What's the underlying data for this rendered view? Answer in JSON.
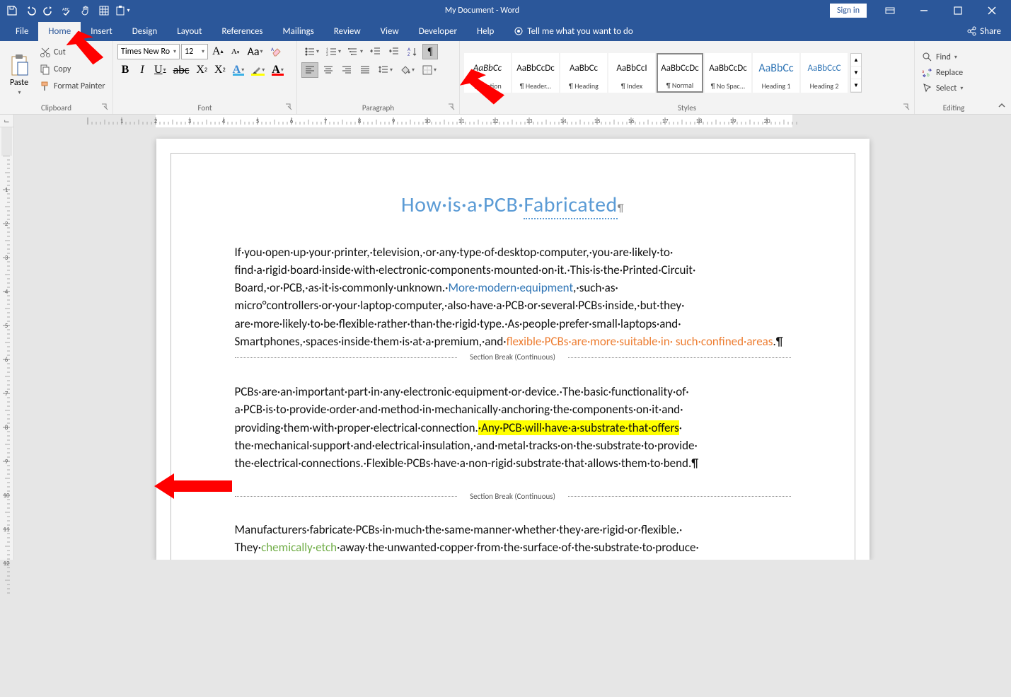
{
  "titlebar": {
    "title": "My Document  -  Word",
    "signin": "Sign in"
  },
  "tabs": {
    "file": "File",
    "home": "Home",
    "insert": "Insert",
    "design": "Design",
    "layout": "Layout",
    "references": "References",
    "mailings": "Mailings",
    "review": "Review",
    "view": "View",
    "developer": "Developer",
    "help": "Help",
    "tellme": "Tell me what you want to do",
    "share": "Share"
  },
  "ribbon": {
    "clipboard": {
      "label": "Clipboard",
      "paste": "Paste",
      "cut": "Cut",
      "copy": "Copy",
      "format_painter": "Format Painter"
    },
    "font": {
      "label": "Font",
      "name": "Times New Ro",
      "size": "12"
    },
    "paragraph": {
      "label": "Paragraph"
    },
    "styles": {
      "label": "Styles",
      "items": [
        {
          "preview": "AaBbCc",
          "name": "¶ Caption",
          "italic": true
        },
        {
          "preview": "AaBbCcDc",
          "name": "¶ Header..."
        },
        {
          "preview": "AaBbCc",
          "name": "¶ Heading"
        },
        {
          "preview": "AaBbCcI",
          "name": "¶ Index"
        },
        {
          "preview": "AaBbCcDc",
          "name": "¶ Normal",
          "selected": true
        },
        {
          "preview": "AaBbCcDc",
          "name": "¶ No Spac..."
        },
        {
          "preview": "AaBbCc",
          "name": "Heading 1",
          "color": "#2e74b5",
          "size": "16px"
        },
        {
          "preview": "AaBbCcC",
          "name": "Heading 2",
          "color": "#2e74b5"
        }
      ]
    },
    "editing": {
      "label": "Editing",
      "find": "Find",
      "replace": "Replace",
      "select": "Select"
    }
  },
  "document": {
    "title_pre": "How·is·a·PCB·",
    "title_u": "Fabricated",
    "title_mark": "¶",
    "p1_a": "If·you·open·up·your·printer,·television,·or·any·type·of·desktop·computer,·you·are·likely·to· find·a·rigid·board·inside·with·electronic·components·mounted·on·it.·This·is·the·Printed·Circuit· Board,·or·PCB,·as·it·is·commonly·unknown.·",
    "p1_link1": "More·modern·equipment",
    "p1_b": ",·such·as· micro°controllers·or·your·laptop·computer,·also·have·a·PCB·or·several·PCBs·inside,·but·they· are·more·likely·to·be·flexible·rather·than·the·rigid·type.·As·people·prefer·small·laptops·and· Smartphones,·spaces·inside·them·is·at·a·premium,·and·",
    "p1_link2": "flexible·PCBs·are·more·suitable·in· such·confined·areas",
    "p1_c": ".¶",
    "sb1": "Section Break (Continuous)",
    "p2_a": "PCBs·are·an·important·part·in·any·electronic·equipment·or·device.·The·basic·functionality·of· a·PCB·is·to·provide·order·and·method·in·mechanically·anchoring·the·components·on·it·and· providing·them·with·proper·electrical·connection.",
    "p2_hl": "·Any·PCB·will·have·a·substrate·that·offers",
    "p2_b": "· the·mechanical·support·and·electrical·insulation,·and·metal·tracks·on·the·substrate·to·provide· the·electrical·connections.·Flexible·PCBs·have·a·non-rigid·substrate·that·allows·them·to·bend.¶",
    "sb2": "Section Break (Continuous)",
    "p3_a": "Manufacturers·fabricate·PCBs·in·much·the·same·manner·whether·they·are·rigid·or·flexible.· They·",
    "p3_link": "chemically·etch",
    "p3_b": "·away·the·unwanted·copper·from·the·surface·of·the·substrate·to·produce· the·PCB.·They·need·to·drill·holes·in·the·PCB·to·allow·mounting·of·through-hole·components.·"
  }
}
